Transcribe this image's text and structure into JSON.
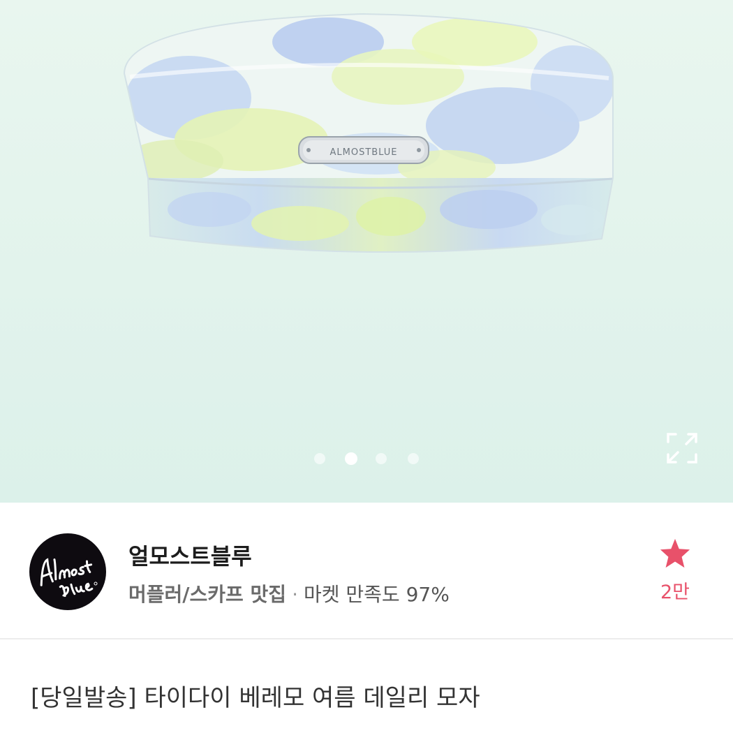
{
  "product": {
    "image_name": "tie-dye-beret-image",
    "brand_plate_text": "ALMOSTBLUE",
    "title": "[당일발송] 타이다이 베레모 여름 데일리 모자"
  },
  "gallery": {
    "slide_count": 4,
    "active_index": 1,
    "expand_icon": "expand-icon"
  },
  "seller": {
    "logo_text_line1": "Almost",
    "logo_text_line2": "Blue",
    "name": "얼모스트블루",
    "category_tag": "머플러/스카프 맛집",
    "separator": "·",
    "satisfaction": "마켓 만족도 97%",
    "favorite_icon": "star-icon",
    "favorite_count": "2만"
  },
  "colors": {
    "accent": "#e8516a",
    "background_mint": "#e2f3ec"
  }
}
